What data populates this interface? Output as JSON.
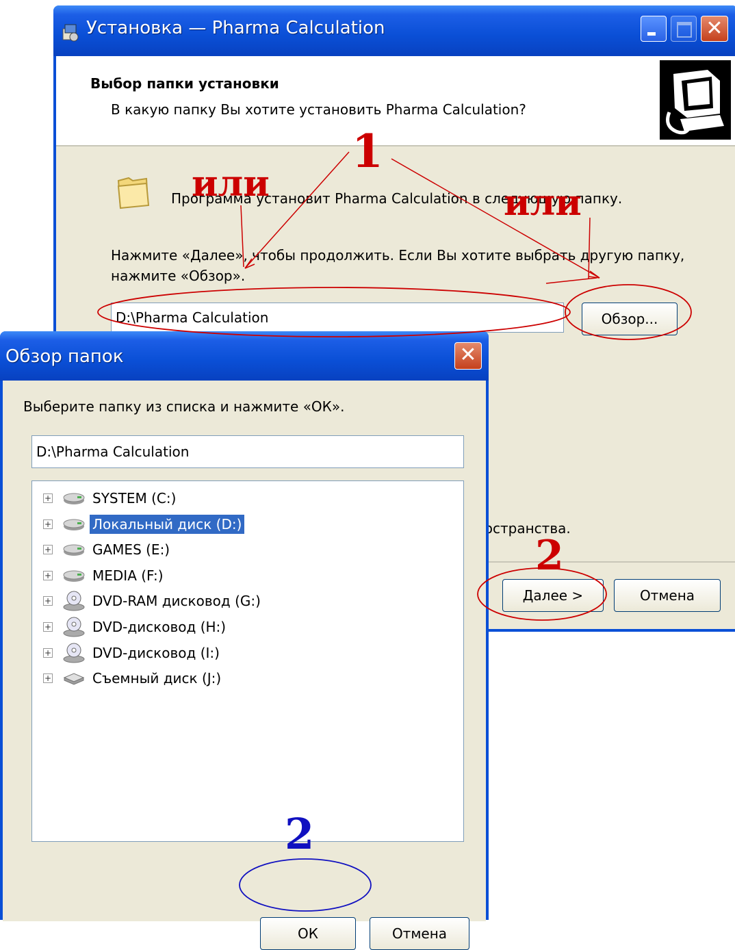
{
  "setup": {
    "title": "Установка — Pharma Calculation",
    "heading": "Выбор папки установки",
    "subheading": "В какую папку Вы хотите установить Pharma Calculation?",
    "info": "Программа установит Pharma Calculation в следующую папку.",
    "instructions": "Нажмите «Далее», чтобы продолжить. Если Вы хотите выбрать другую папку, нажмите «Обзор».",
    "path_value": "D:\\Pharma Calculation",
    "browse_label": "Обзор...",
    "space_text": "пространства.",
    "next_label": "Далее >",
    "cancel_label": "Отмена"
  },
  "browse_dialog": {
    "title": "Обзор папок",
    "prompt": "Выберите папку из списка и нажмите «ОК».",
    "path_value": "D:\\Pharma Calculation",
    "tree": [
      {
        "label": "SYSTEM (C:)",
        "icon": "hard-drive-icon",
        "selected": false
      },
      {
        "label": "Локальный диск (D:)",
        "icon": "hard-drive-icon",
        "selected": true
      },
      {
        "label": "GAMES (E:)",
        "icon": "hard-drive-icon",
        "selected": false
      },
      {
        "label": "MEDIA (F:)",
        "icon": "hard-drive-icon",
        "selected": false
      },
      {
        "label": "DVD-RAM дисковод (G:)",
        "icon": "dvd-drive-icon",
        "selected": false
      },
      {
        "label": "DVD-дисковод (H:)",
        "icon": "dvd-drive-icon",
        "selected": false
      },
      {
        "label": "DVD-дисковод (I:)",
        "icon": "dvd-drive-icon",
        "selected": false
      },
      {
        "label": "Съемный диск (J:)",
        "icon": "removable-drive-icon",
        "selected": false
      }
    ],
    "expand_glyph": "+",
    "ok_label": "ОК",
    "cancel_label": "Отмена"
  },
  "annotations": {
    "step1": "1",
    "or_left": "или",
    "or_right": "или",
    "step2_setup": "2",
    "step2_dialog": "2"
  },
  "colors": {
    "annotation_red": "#cc0000",
    "annotation_blue": "#1010c0",
    "xp_title_blue": "#0a4fd6",
    "selection": "#316ac5"
  }
}
